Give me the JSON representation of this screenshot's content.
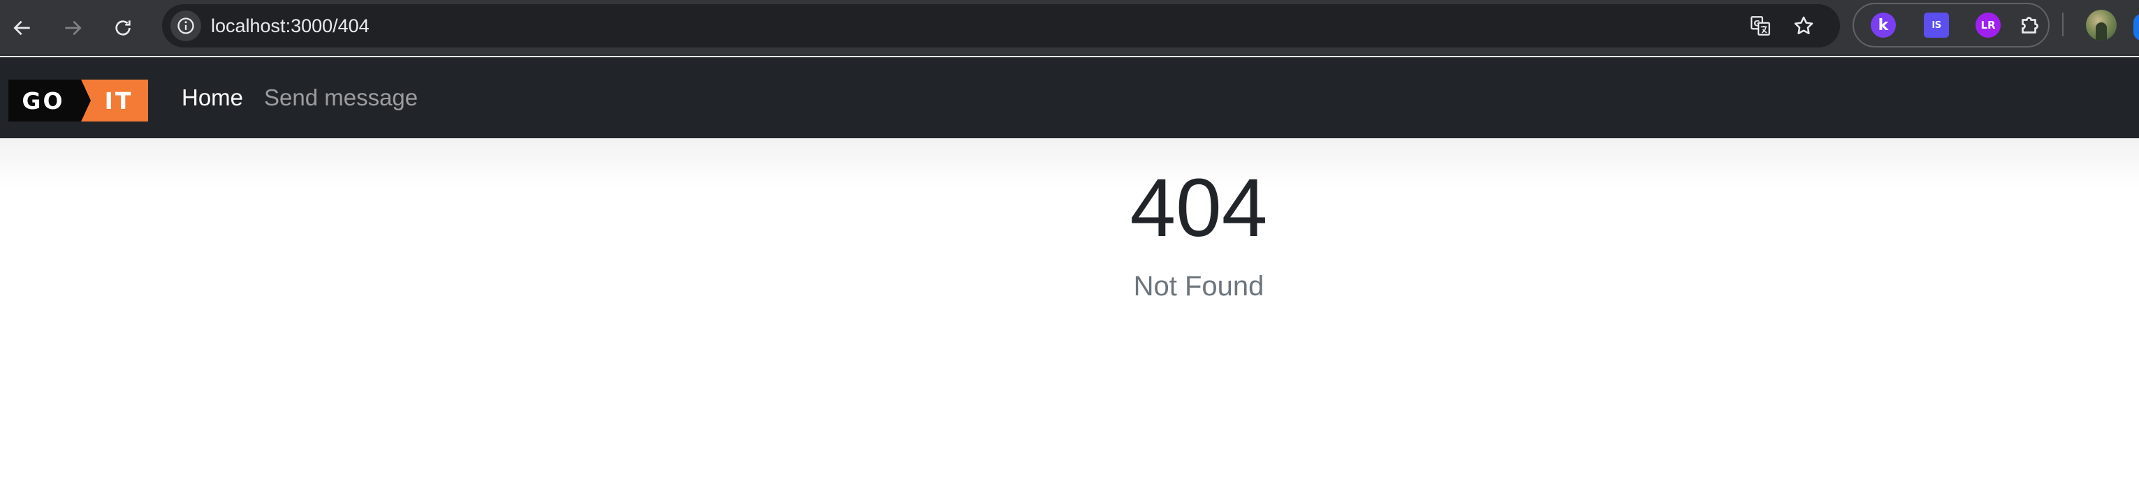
{
  "browser": {
    "url": "localhost:3000/404",
    "icons": {
      "back": "arrow-left-icon",
      "forward": "arrow-right-icon",
      "reload": "reload-icon",
      "site_info": "info-icon",
      "translate": "translate-icon",
      "bookmark": "star-icon",
      "extensions": "puzzle-icon"
    },
    "extensions": [
      {
        "label": "k",
        "color": "#7a3ff2"
      },
      {
        "label": "IS",
        "color": "#5b4ff0"
      },
      {
        "label": "LR",
        "color": "#a020f0"
      }
    ]
  },
  "navbar": {
    "logo": {
      "left": "GO",
      "right": "IT",
      "accent_color": "#f47b36"
    },
    "links": [
      {
        "label": "Home",
        "active": true
      },
      {
        "label": "Send message",
        "active": false
      }
    ]
  },
  "error": {
    "code": "404",
    "message": "Not Found"
  },
  "colors": {
    "chrome_bg": "#35363a",
    "omnibox_bg": "#202124",
    "navbar_bg": "#212529",
    "text_dark": "#212529",
    "text_muted": "#6c757d"
  }
}
